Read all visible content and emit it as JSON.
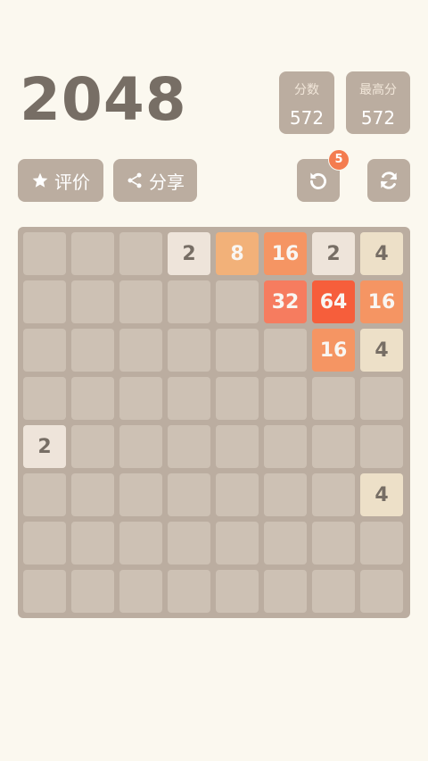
{
  "header": {
    "title": "2048",
    "score_label": "分数",
    "score_value": "572",
    "best_label": "最高分",
    "best_value": "572"
  },
  "toolbar": {
    "rate_label": "评价",
    "rate_icon": "star-icon",
    "share_label": "分享",
    "share_icon": "share-icon",
    "undo_icon": "undo-icon",
    "undo_badge": "5",
    "restart_icon": "refresh-icon"
  },
  "colors": {
    "background": "#fbf8ef",
    "board": "#bbada0",
    "empty_cell": "#cdc1b4",
    "title_text": "#776e65",
    "tile_2": "#eee4da",
    "tile_4": "#ede0c8",
    "tile_8": "#f2b179",
    "tile_16": "#f59563",
    "tile_32": "#f67c5f",
    "tile_64": "#f65e3b",
    "badge": "#f47c4f"
  },
  "board": {
    "size": 8,
    "grid": [
      [
        "",
        "",
        "",
        "2",
        "8",
        "16",
        "2",
        "4"
      ],
      [
        "",
        "",
        "",
        "",
        "",
        "32",
        "64",
        "16"
      ],
      [
        "",
        "",
        "",
        "",
        "",
        "",
        "16",
        "4"
      ],
      [
        "",
        "",
        "",
        "",
        "",
        "",
        "",
        ""
      ],
      [
        "2",
        "",
        "",
        "",
        "",
        "",
        "",
        ""
      ],
      [
        "",
        "",
        "",
        "",
        "",
        "",
        "",
        "4"
      ],
      [
        "",
        "",
        "",
        "",
        "",
        "",
        "",
        ""
      ],
      [
        "",
        "",
        "",
        "",
        "",
        "",
        "",
        ""
      ]
    ]
  }
}
